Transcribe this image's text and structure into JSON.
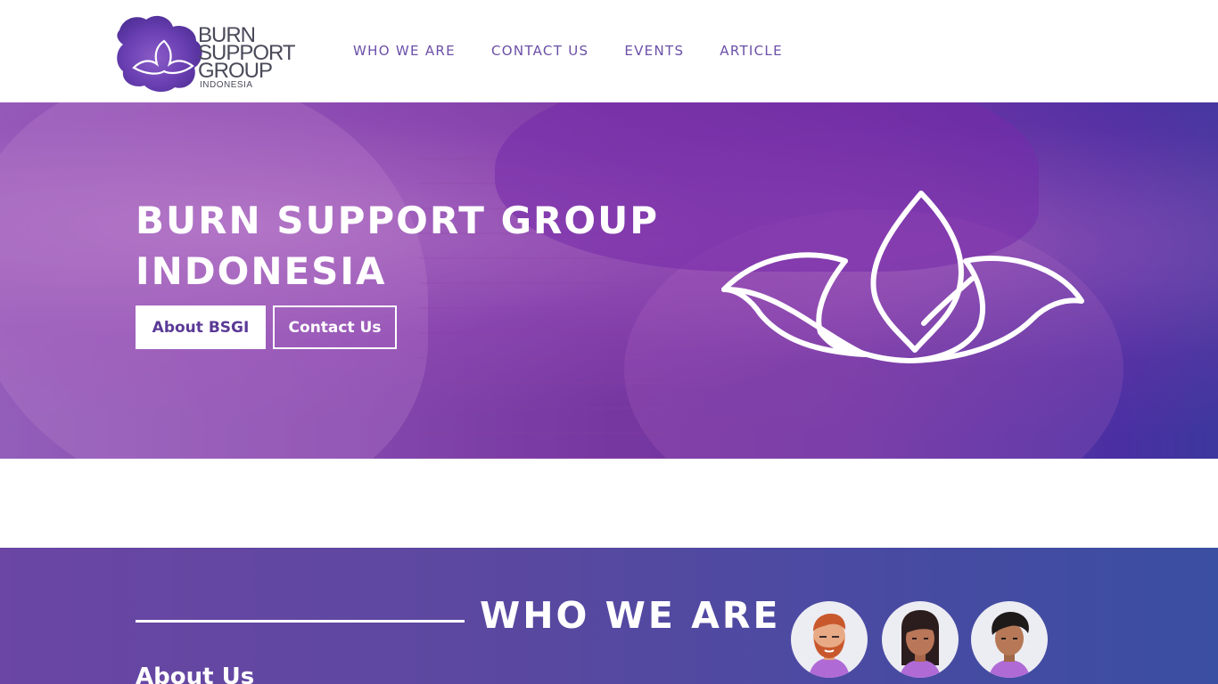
{
  "header": {
    "logo": {
      "line1": "BURN",
      "line2": "SUPPORT",
      "line3": "GROUP",
      "line4": "INDONESIA",
      "mark_icon": "lotus-icon"
    },
    "nav": [
      {
        "label": "WHO WE ARE"
      },
      {
        "label": "CONTACT US"
      },
      {
        "label": "EVENTS"
      },
      {
        "label": "ARTICLE"
      }
    ]
  },
  "hero": {
    "title_line1": "BURN SUPPORT GROUP",
    "title_line2": "INDONESIA",
    "btn_about": "About BSGI",
    "btn_contact": "Contact Us",
    "icon": "lotus-icon"
  },
  "who": {
    "title": "WHO WE ARE",
    "subheading": "About Us",
    "avatars": [
      "bearded-man-avatar-icon",
      "woman-avatar-icon",
      "man-avatar-icon"
    ]
  },
  "colors": {
    "brand_purple": "#6b4fa8",
    "button_text": "#5b3a96",
    "section_gradient_start": "#6b46a4",
    "section_gradient_end": "#3a4ea2",
    "white": "#ffffff"
  }
}
